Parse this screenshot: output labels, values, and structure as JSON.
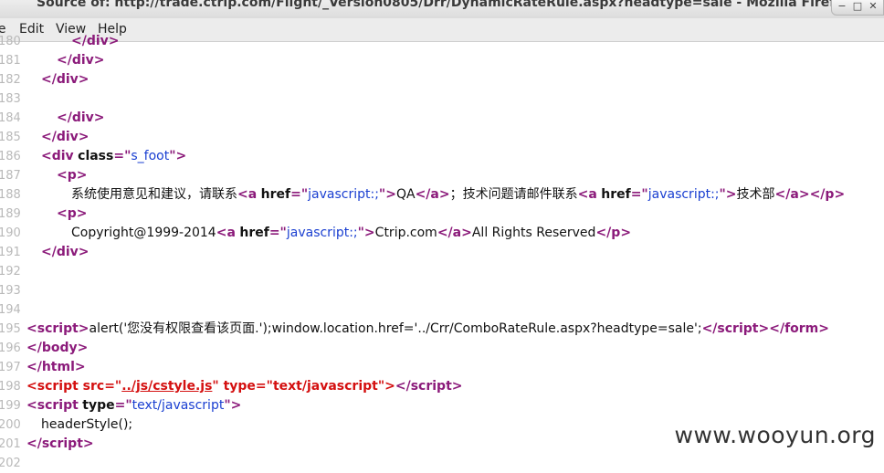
{
  "window": {
    "title": "Source of: http://trade.ctrip.com/Flight/_Version0805/Drr/DynamicRateRule.aspx?headtype=sale - Mozilla Firefox"
  },
  "menu": {
    "items": [
      {
        "label": "le"
      },
      {
        "label": "Edit"
      },
      {
        "label": "View"
      },
      {
        "label": "Help"
      }
    ]
  },
  "source": {
    "lines": [
      {
        "n": "180",
        "indent": 78,
        "tokens": [
          [
            "p",
            "</"
          ],
          [
            "t",
            "div"
          ],
          [
            "p",
            ">"
          ]
        ]
      },
      {
        "n": "181",
        "indent": 62,
        "tokens": [
          [
            "p",
            "</"
          ],
          [
            "t",
            "div"
          ],
          [
            "p",
            ">"
          ]
        ]
      },
      {
        "n": "182",
        "indent": 45,
        "tokens": [
          [
            "p",
            "</"
          ],
          [
            "t",
            "div"
          ],
          [
            "p",
            ">"
          ]
        ]
      },
      {
        "n": "183",
        "indent": 0,
        "tokens": []
      },
      {
        "n": "184",
        "indent": 62,
        "tokens": [
          [
            "p",
            "</"
          ],
          [
            "t",
            "div"
          ],
          [
            "p",
            ">"
          ]
        ]
      },
      {
        "n": "185",
        "indent": 45,
        "tokens": [
          [
            "p",
            "</"
          ],
          [
            "t",
            "div"
          ],
          [
            "p",
            ">"
          ]
        ]
      },
      {
        "n": "186",
        "indent": 45,
        "tokens": [
          [
            "p",
            "<"
          ],
          [
            "t",
            "div"
          ],
          [
            "x",
            " "
          ],
          [
            "a",
            "class"
          ],
          [
            "p",
            "=\""
          ],
          [
            "v",
            "s_foot"
          ],
          [
            "p",
            "\">"
          ]
        ]
      },
      {
        "n": "187",
        "indent": 62,
        "tokens": [
          [
            "p",
            "<"
          ],
          [
            "t",
            "p"
          ],
          [
            "p",
            ">"
          ]
        ]
      },
      {
        "n": "188",
        "indent": 78,
        "tokens": [
          [
            "x",
            "系统使用意见和建议，请联系"
          ],
          [
            "p",
            "<"
          ],
          [
            "t",
            "a"
          ],
          [
            "x",
            " "
          ],
          [
            "a",
            "href"
          ],
          [
            "p",
            "=\""
          ],
          [
            "v",
            "javascript:;"
          ],
          [
            "p",
            "\">"
          ],
          [
            "x",
            "QA"
          ],
          [
            "p",
            "</"
          ],
          [
            "t",
            "a"
          ],
          [
            "p",
            ">"
          ],
          [
            "x",
            "；技术问题请邮件联系"
          ],
          [
            "p",
            "<"
          ],
          [
            "t",
            "a"
          ],
          [
            "x",
            " "
          ],
          [
            "a",
            "href"
          ],
          [
            "p",
            "=\""
          ],
          [
            "v",
            "javascript:;"
          ],
          [
            "p",
            "\">"
          ],
          [
            "x",
            "技术部"
          ],
          [
            "p",
            "</"
          ],
          [
            "t",
            "a"
          ],
          [
            "p",
            "></"
          ],
          [
            "t",
            "p"
          ],
          [
            "p",
            ">"
          ]
        ]
      },
      {
        "n": "189",
        "indent": 62,
        "tokens": [
          [
            "p",
            "<"
          ],
          [
            "t",
            "p"
          ],
          [
            "p",
            ">"
          ]
        ]
      },
      {
        "n": "190",
        "indent": 78,
        "tokens": [
          [
            "x",
            "Copyright@1999-2014"
          ],
          [
            "p",
            "<"
          ],
          [
            "t",
            "a"
          ],
          [
            "x",
            " "
          ],
          [
            "a",
            "href"
          ],
          [
            "p",
            "=\""
          ],
          [
            "v",
            "javascript:;"
          ],
          [
            "p",
            "\">"
          ],
          [
            "x",
            "Ctrip.com"
          ],
          [
            "p",
            "</"
          ],
          [
            "t",
            "a"
          ],
          [
            "p",
            ">"
          ],
          [
            "x",
            "All Rights Reserved"
          ],
          [
            "p",
            "</"
          ],
          [
            "t",
            "p"
          ],
          [
            "p",
            ">"
          ]
        ]
      },
      {
        "n": "191",
        "indent": 45,
        "tokens": [
          [
            "p",
            "</"
          ],
          [
            "t",
            "div"
          ],
          [
            "p",
            ">"
          ]
        ]
      },
      {
        "n": "192",
        "indent": 0,
        "tokens": []
      },
      {
        "n": "193",
        "indent": 0,
        "tokens": []
      },
      {
        "n": "194",
        "indent": 0,
        "tokens": []
      },
      {
        "n": "195",
        "indent": 29,
        "tokens": [
          [
            "p",
            "<"
          ],
          [
            "t",
            "script"
          ],
          [
            "p",
            ">"
          ],
          [
            "x",
            "alert('您没有权限查看该页面.');window.location.href='../Crr/ComboRateRule.aspx?headtype=sale';"
          ],
          [
            "p",
            "</"
          ],
          [
            "t",
            "script"
          ],
          [
            "p",
            "></"
          ],
          [
            "t",
            "form"
          ],
          [
            "p",
            ">"
          ]
        ]
      },
      {
        "n": "196",
        "indent": 29,
        "tokens": [
          [
            "p",
            "</"
          ],
          [
            "t",
            "body"
          ],
          [
            "p",
            ">"
          ]
        ]
      },
      {
        "n": "197",
        "indent": 29,
        "tokens": [
          [
            "p",
            "</"
          ],
          [
            "t",
            "html"
          ],
          [
            "p",
            ">"
          ]
        ]
      },
      {
        "n": "198",
        "indent": 29,
        "tokens": [
          [
            "r",
            "<script src=\""
          ],
          [
            "l",
            "../js/cstyle.js"
          ],
          [
            "r",
            "\" type=\"text/javascript\">"
          ],
          [
            "p",
            "</"
          ],
          [
            "t",
            "script"
          ],
          [
            "p",
            ">"
          ]
        ]
      },
      {
        "n": "199",
        "indent": 29,
        "tokens": [
          [
            "p",
            "<"
          ],
          [
            "t",
            "script"
          ],
          [
            "x",
            " "
          ],
          [
            "a",
            "type"
          ],
          [
            "p",
            "=\""
          ],
          [
            "v",
            "text/javascript"
          ],
          [
            "p",
            "\">"
          ]
        ]
      },
      {
        "n": "200",
        "indent": 45,
        "tokens": [
          [
            "x",
            "headerStyle();"
          ]
        ]
      },
      {
        "n": "201",
        "indent": 29,
        "tokens": [
          [
            "p",
            "</"
          ],
          [
            "t",
            "script"
          ],
          [
            "p",
            ">"
          ]
        ]
      },
      {
        "n": "202",
        "indent": 0,
        "tokens": []
      }
    ]
  },
  "watermark": "www.wooyun.org",
  "colors": {
    "tag": "#8b1a7a",
    "value": "#1a3fd1",
    "error": "#d41010",
    "line_number": "#b9b9b9"
  }
}
